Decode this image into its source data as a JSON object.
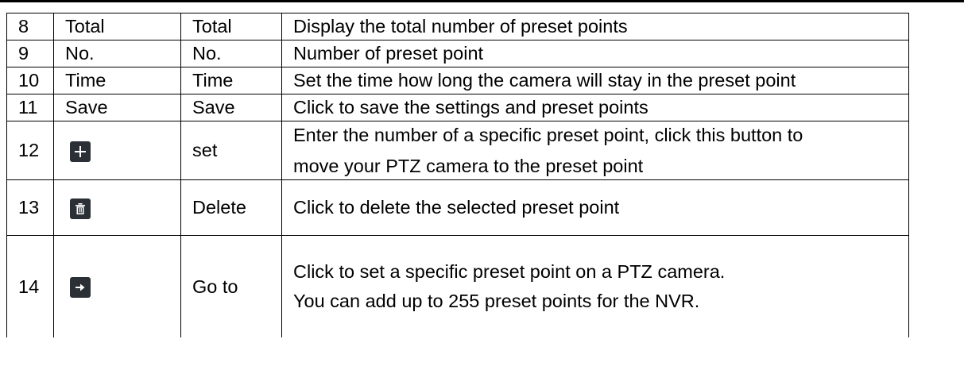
{
  "colors": {
    "button_bg": "#2b3036",
    "button_icon": "#ffffff"
  },
  "rows": [
    {
      "num": "8",
      "name": "Total",
      "label": "Total",
      "description": [
        "Display the total number of preset points"
      ]
    },
    {
      "num": "9",
      "name": "No.",
      "label": "No.",
      "description": [
        "Number of preset point"
      ]
    },
    {
      "num": "10",
      "name": "Time",
      "label": "Time",
      "description": [
        "Set the time how long the camera will stay in the preset point"
      ]
    },
    {
      "num": "11",
      "name": "Save",
      "label": "Save",
      "description": [
        "Click to save the settings and preset points"
      ]
    },
    {
      "num": "12",
      "icon": "plus-icon",
      "label": "set",
      "description": [
        "Enter the number of a specific preset point, click this button to",
        "move your PTZ camera to the preset point"
      ]
    },
    {
      "num": "13",
      "icon": "trash-icon",
      "label": "Delete",
      "description": [
        "Click to delete the selected preset point"
      ]
    },
    {
      "num": "14",
      "icon": "arrow-right-icon",
      "label": "Go to",
      "description": [
        "Click to set a specific preset point on a PTZ camera.",
        "You can add up to 255 preset points for the NVR."
      ]
    }
  ]
}
